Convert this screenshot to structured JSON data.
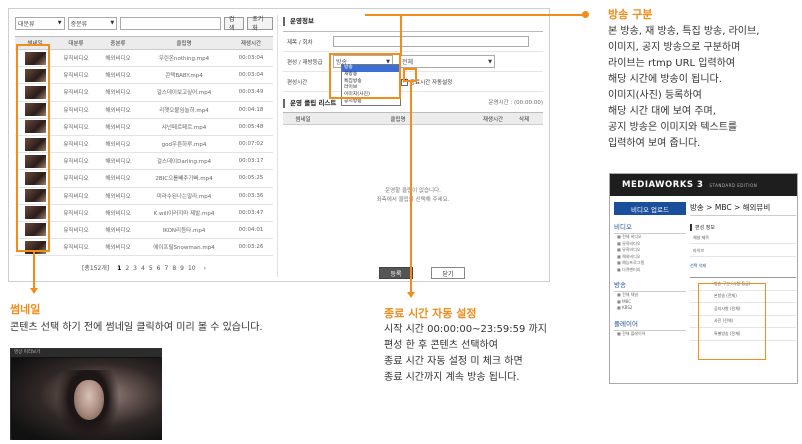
{
  "colors": {
    "accent": "#f28c1b",
    "brand_blue": "#1a4f9c"
  },
  "filters": {
    "category1": "대분류",
    "category2": "중분류",
    "search_label": "검색",
    "reset_label": "초기화"
  },
  "table": {
    "headers": [
      "썸네일",
      "대분류",
      "중분류",
      "클립명",
      "재생시간"
    ],
    "rows": [
      {
        "cat1": "뮤직비디오",
        "cat2": "해외비디오",
        "name": "우린온nothing.mp4",
        "duration": "00:03:04"
      },
      {
        "cat1": "뮤직비디오",
        "cat2": "해외비디오",
        "name": "콘택BABY.mp4",
        "duration": "00:03:04"
      },
      {
        "cat1": "뮤직비디오",
        "cat2": "해외비디오",
        "name": "걸스데이보고싶어.mp4",
        "duration": "00:03:49"
      },
      {
        "cat1": "뮤직비디오",
        "cat2": "해외비디오",
        "name": "리햇오붙임늘하.mp4",
        "duration": "00:04:18"
      },
      {
        "cat1": "뮤직비디오",
        "cat2": "해외비디오",
        "name": "샤넌페르페르.mp4",
        "duration": "00:05:48"
      },
      {
        "cat1": "뮤직비디오",
        "cat2": "해외비디오",
        "name": "god우른하루.mp4",
        "duration": "00:07:02"
      },
      {
        "cat1": "뮤직비디오",
        "cat2": "해외비디오",
        "name": "걸스데이Darling.mp4",
        "duration": "00:03:17"
      },
      {
        "cat1": "뮤직비디오",
        "cat2": "해외비디오",
        "name": "2BIC으를빼주기뻐.mp4",
        "duration": "00:05:25"
      },
      {
        "cat1": "뮤직비디오",
        "cat2": "해외비디오",
        "name": "미라수된나는말라.mp4",
        "duration": "00:03:36"
      },
      {
        "cat1": "뮤직비디오",
        "cat2": "해외비디오",
        "name": "K.will이러지마 제발.mp4",
        "duration": "00:03:47"
      },
      {
        "cat1": "뮤직비디오",
        "cat2": "해외비디오",
        "name": "IKON리듬타.mp4",
        "duration": "00:04:01"
      },
      {
        "cat1": "뮤직비디오",
        "cat2": "해외비디오",
        "name": "에이프릴Snowman.mp4",
        "duration": "00:03:26"
      }
    ]
  },
  "pagination": {
    "total": "[총152개]",
    "pages": [
      "1",
      "2",
      "3",
      "4",
      "5",
      "6",
      "7",
      "8",
      "9",
      "10"
    ],
    "current": "1",
    "next": "›"
  },
  "form": {
    "title": "운영정보",
    "fields": {
      "title_label": "제목 / 회차",
      "type_label": "편성 / 재방등급",
      "type_value": "방송",
      "grade_value": "전체",
      "time_label": "편성시간",
      "auto_end_label": "종료시간 자동설정"
    },
    "type_options": [
      "방송",
      "재방송",
      "특집방송",
      "라이브",
      "이미지(사진)",
      "공지방송"
    ],
    "selected_option": "방송"
  },
  "clip_list": {
    "title": "운영 클립 리스트",
    "runtime_label": "운영시간 : (00:00:00)",
    "headers": [
      "썸네일",
      "클립명",
      "재생시간",
      "삭제"
    ],
    "empty_line1": "운영할 클립이 없습니다.",
    "empty_line2": "좌측에서 클립을 선택해 주세요."
  },
  "buttons": {
    "register": "등록",
    "close": "닫기"
  },
  "callouts": {
    "broadcast_type": {
      "title": "방송 구분",
      "body": "본 방송, 재 방송, 특집 방송, 라이브,\n이미지, 공지 방송으로 구분하며\n라이브는 rtmp URL 입력하여\n해당 시간에 방송이 됩니다.\n이미지(사진) 등록하여\n해당 시간 대에 보여 주며,\n공지 방송은 이미지와 텍스트를\n입력하여 보여 줍니다."
    },
    "thumbnail": {
      "title": "썸네일",
      "body": "콘텐츠 선택 하기 전에 썸네일 클릭하여 미리 볼 수 있습니다."
    },
    "auto_end": {
      "title": "종료 시간 자동 설정",
      "body": "시작 시간 00:00:00~23:59:59 까지\n편성 한 후 콘텐츠 선택하여\n종료 시간 자동 설정 미 체크 하면\n종료 시간까지 계속 방송 됩니다."
    }
  },
  "preview": {
    "bar_label": "영상 미리보기"
  },
  "inset": {
    "logo": "MEDIAWORKS 3",
    "edition": "STANDARD EDITION",
    "upload_label": "비디오 업로드",
    "section_video": "비디오",
    "video_items": [
      "전체 비디오",
      "뮤직비디오",
      "뮤직비디오",
      "해외비디오",
      "예능프로그램",
      "다큐멘터리"
    ],
    "section_broadcast": "방송",
    "broadcast_items": [
      "전체 채널",
      "MBC",
      "KBS2"
    ],
    "section_playlist": "플레이어",
    "playlist_items": [
      "전체 플레이어"
    ],
    "breadcrumb": "방송 > MBC > 해외뮤비",
    "sub_title": "편성 정보",
    "sub_rows": [
      "채널 제목",
      "라이브"
    ],
    "tab_label": "선택 삭제",
    "table_rows": [
      "방송 구분 (시청 등급)",
      "본방송 (전체)",
      "공지사항 (전체)",
      "사진 (전체)",
      "특별방송 (전체)"
    ]
  }
}
